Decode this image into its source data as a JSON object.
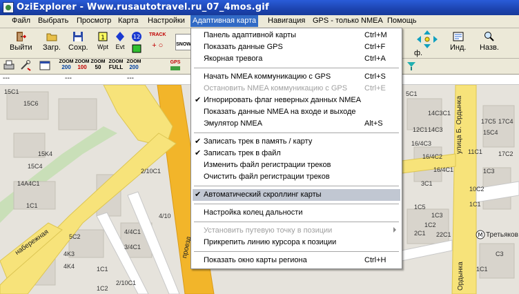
{
  "window": {
    "title": "OziExplorer - Www.rusautotravel.ru_07_4mos.gif"
  },
  "menubar": {
    "items": [
      "Файл",
      "Выбрать",
      "Просмотр",
      "Карта",
      "Настройки",
      "Адаптивная карта",
      "Навигация",
      "GPS - только NMEA",
      "Помощь"
    ]
  },
  "toolbar": {
    "exit_label": "Выйти",
    "load_label": "Загр.",
    "save_label": "Сохр.",
    "wpt_label": "Wpt",
    "evt_label": "Evt",
    "track_label": "TRACK",
    "snow_label": "SNOW",
    "nav_label": "ф.",
    "ind_label": "Инд.",
    "names_label": "Назв.",
    "zoom_word": "ZOOM",
    "zoom_values": [
      "200",
      "100",
      "50",
      "FULL",
      "200"
    ],
    "gps_label": "GPS"
  },
  "coordbar": {
    "values": [
      "---",
      "---",
      "---"
    ]
  },
  "dropdown": {
    "items": [
      {
        "label": "Панель адаптивной карты",
        "shortcut": "Ctrl+M"
      },
      {
        "label": "Показать данные GPS",
        "shortcut": "Ctrl+F"
      },
      {
        "label": "Якорная тревога",
        "shortcut": "Ctrl+A"
      },
      {
        "label": "Начать NMEA коммуникацию с GPS",
        "shortcut": "Ctrl+S"
      },
      {
        "label": "Остановить NMEA коммуникацию с GPS",
        "shortcut": "Ctrl+E"
      },
      {
        "label": "Игнорировать флаг неверных данных NMEA",
        "shortcut": ""
      },
      {
        "label": "Показать данные NMEA на входе и выходе",
        "shortcut": ""
      },
      {
        "label": "Эмулятор NMEA",
        "shortcut": "Alt+S"
      },
      {
        "label": "Записать трек в память / карту",
        "shortcut": ""
      },
      {
        "label": "Записать трек в файл",
        "shortcut": ""
      },
      {
        "label": "Изменить файл регистрации треков",
        "shortcut": ""
      },
      {
        "label": "Очистить файл регистрации треков",
        "shortcut": ""
      },
      {
        "label": "Автоматический скроллинг карты",
        "shortcut": ""
      },
      {
        "label": "Настройка колец дальности",
        "shortcut": ""
      },
      {
        "label": "Установить путевую точку в позиции",
        "shortcut": ""
      },
      {
        "label": "Прикрепить линию курсора к позиции",
        "shortcut": ""
      },
      {
        "label": "Показать окно карты региона",
        "shortcut": "Ctrl+H"
      }
    ],
    "check_glyph": "✔"
  },
  "map": {
    "labels": [
      "15C1",
      "15C6",
      "15K4",
      "15C4",
      "14А4С1",
      "1C1",
      "2/10C1",
      "4/10",
      "4/4C1",
      "3/4C1",
      "5C2",
      "4K3",
      "4K4",
      "2/10C1",
      "1C1",
      "1C2",
      "5C1",
      "14C3C1",
      "14C3",
      "12C1",
      "16/4C3",
      "16/4C2",
      "16/4C1",
      "3C1",
      "1C5",
      "1C3",
      "1C2",
      "2C1",
      "22C1",
      "17C5",
      "17C4",
      "15C4",
      "17C2",
      "11C1",
      "10C2",
      "1C3",
      "1C1",
      "C3",
      "1C1"
    ],
    "streets": [
      "набережная",
      "проезд",
      "улица Б. Ордынка",
      "Ордынка",
      "Третьяков"
    ]
  }
}
